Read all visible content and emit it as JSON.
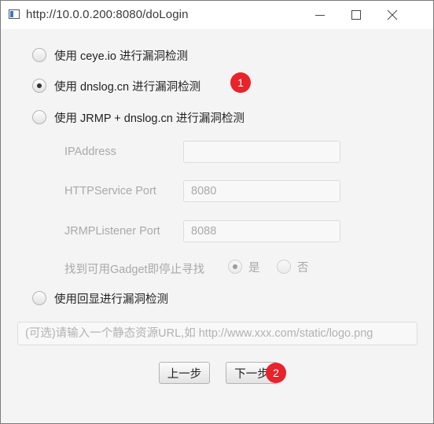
{
  "window": {
    "title": "http://10.0.0.200:8080/doLogin"
  },
  "options": [
    {
      "label": "使用 ceye.io 进行漏洞检测",
      "checked": false
    },
    {
      "label": "使用 dnslog.cn 进行漏洞检测",
      "checked": true
    },
    {
      "label": "使用 JRMP + dnslog.cn 进行漏洞检测",
      "checked": false
    },
    {
      "label": "使用回显进行漏洞检测",
      "checked": false
    }
  ],
  "jrmp": {
    "ip_label": "IPAddress",
    "ip_value": "",
    "http_label": "HTTPService Port",
    "http_value": "8080",
    "listener_label": "JRMPListener Port",
    "listener_value": "8088",
    "stop_label": "找到可用Gadget即停止寻找",
    "yes_label": "是",
    "no_label": "否",
    "stop_selected": "是"
  },
  "url_input": {
    "placeholder": "(可选)请输入一个静态资源URL,如 http://www.xxx.com/static/logo.png"
  },
  "buttons": {
    "prev": "上一步",
    "next": "下一步"
  },
  "annotations": [
    "1",
    "2"
  ],
  "colors": {
    "badge": "#e8232b"
  }
}
